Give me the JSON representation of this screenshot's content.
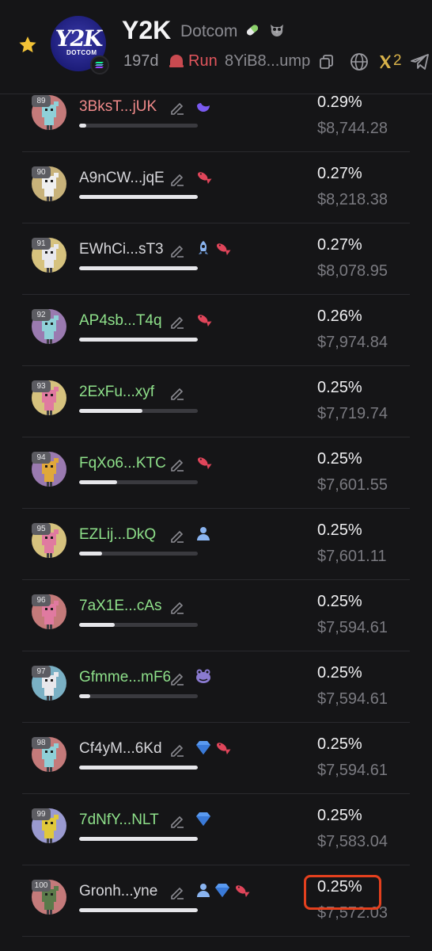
{
  "header": {
    "logo_text": "Y2K",
    "logo_subtext": "DOTCOM",
    "symbol": "Y2K",
    "name": "Dotcom",
    "age": "197d",
    "status": "Run",
    "address": "8YiB8...ump",
    "x_count": "2",
    "colors": {
      "status": "#e0555c",
      "x": "#d8b24a"
    },
    "icons": [
      "star-icon",
      "pill-icon",
      "owl-icon",
      "solana-icon",
      "run-icon",
      "copy-icon",
      "globe-icon",
      "x-icon",
      "telegram-icon"
    ]
  },
  "holders": [
    {
      "rank": "89",
      "wallet": "3BksT...jUK",
      "wallet_color": "#f08a8a",
      "badges": [
        "moon"
      ],
      "bar": 0.06,
      "pct": "0.29%",
      "usd": "$8,744.28",
      "avatar_bg": "#c47a7a",
      "char": "#8fd0d8"
    },
    {
      "rank": "90",
      "wallet": "A9nCW...jqE",
      "wallet_color": "#d6d6da",
      "badges": [
        "fish"
      ],
      "bar": 1.0,
      "pct": "0.27%",
      "usd": "$8,218.38",
      "avatar_bg": "#c8b27a",
      "char": "#f0f0f0"
    },
    {
      "rank": "91",
      "wallet": "EWhCi...sT3",
      "wallet_color": "#d6d6da",
      "badges": [
        "rocket",
        "fish"
      ],
      "bar": 1.0,
      "pct": "0.27%",
      "usd": "$8,078.95",
      "avatar_bg": "#d6c27e",
      "char": "#e8e8ec"
    },
    {
      "rank": "92",
      "wallet": "AP4sb...T4q",
      "wallet_color": "#8ee08a",
      "badges": [
        "fish"
      ],
      "bar": 1.0,
      "pct": "0.26%",
      "usd": "$7,974.84",
      "avatar_bg": "#9a7ab0",
      "char": "#8fd0d8"
    },
    {
      "rank": "93",
      "wallet": "2ExFu...xyf",
      "wallet_color": "#8ee08a",
      "badges": [],
      "bar": 0.53,
      "pct": "0.25%",
      "usd": "$7,719.74",
      "avatar_bg": "#d6c27e",
      "char": "#e07aa0"
    },
    {
      "rank": "94",
      "wallet": "FqXo6...KTC",
      "wallet_color": "#8ee08a",
      "badges": [
        "fish"
      ],
      "bar": 0.32,
      "pct": "0.25%",
      "usd": "$7,601.55",
      "avatar_bg": "#9a7ab0",
      "char": "#e0a83a"
    },
    {
      "rank": "95",
      "wallet": "EZLij...DkQ",
      "wallet_color": "#8ee08a",
      "badges": [
        "user"
      ],
      "bar": 0.19,
      "pct": "0.25%",
      "usd": "$7,601.11",
      "avatar_bg": "#d6c27e",
      "char": "#e07aa0"
    },
    {
      "rank": "96",
      "wallet": "7aX1E...cAs",
      "wallet_color": "#8ee08a",
      "badges": [],
      "bar": 0.3,
      "pct": "0.25%",
      "usd": "$7,594.61",
      "avatar_bg": "#c47a7a",
      "char": "#e07aa0"
    },
    {
      "rank": "97",
      "wallet": "Gfmme...mF6",
      "wallet_color": "#8ee08a",
      "badges": [
        "frog"
      ],
      "bar": 0.09,
      "pct": "0.25%",
      "usd": "$7,594.61",
      "avatar_bg": "#7ab0c4",
      "char": "#e8e8ec"
    },
    {
      "rank": "98",
      "wallet": "Cf4yM...6Kd",
      "wallet_color": "#d6d6da",
      "badges": [
        "diamond",
        "fish"
      ],
      "bar": 1.0,
      "pct": "0.25%",
      "usd": "$7,594.61",
      "avatar_bg": "#c47a7a",
      "char": "#8fd0d8"
    },
    {
      "rank": "99",
      "wallet": "7dNfY...NLT",
      "wallet_color": "#8ee08a",
      "badges": [
        "diamond"
      ],
      "bar": 1.0,
      "pct": "0.25%",
      "usd": "$7,583.04",
      "avatar_bg": "#9a9ad0",
      "char": "#e0c83a"
    },
    {
      "rank": "100",
      "wallet": "Gronh...yne",
      "wallet_color": "#d6d6da",
      "badges": [
        "user",
        "diamond",
        "fish"
      ],
      "bar": 1.0,
      "pct": "0.25%",
      "usd": "$7,572.03",
      "avatar_bg": "#c47a7a",
      "char": "#5a7a4a"
    }
  ]
}
